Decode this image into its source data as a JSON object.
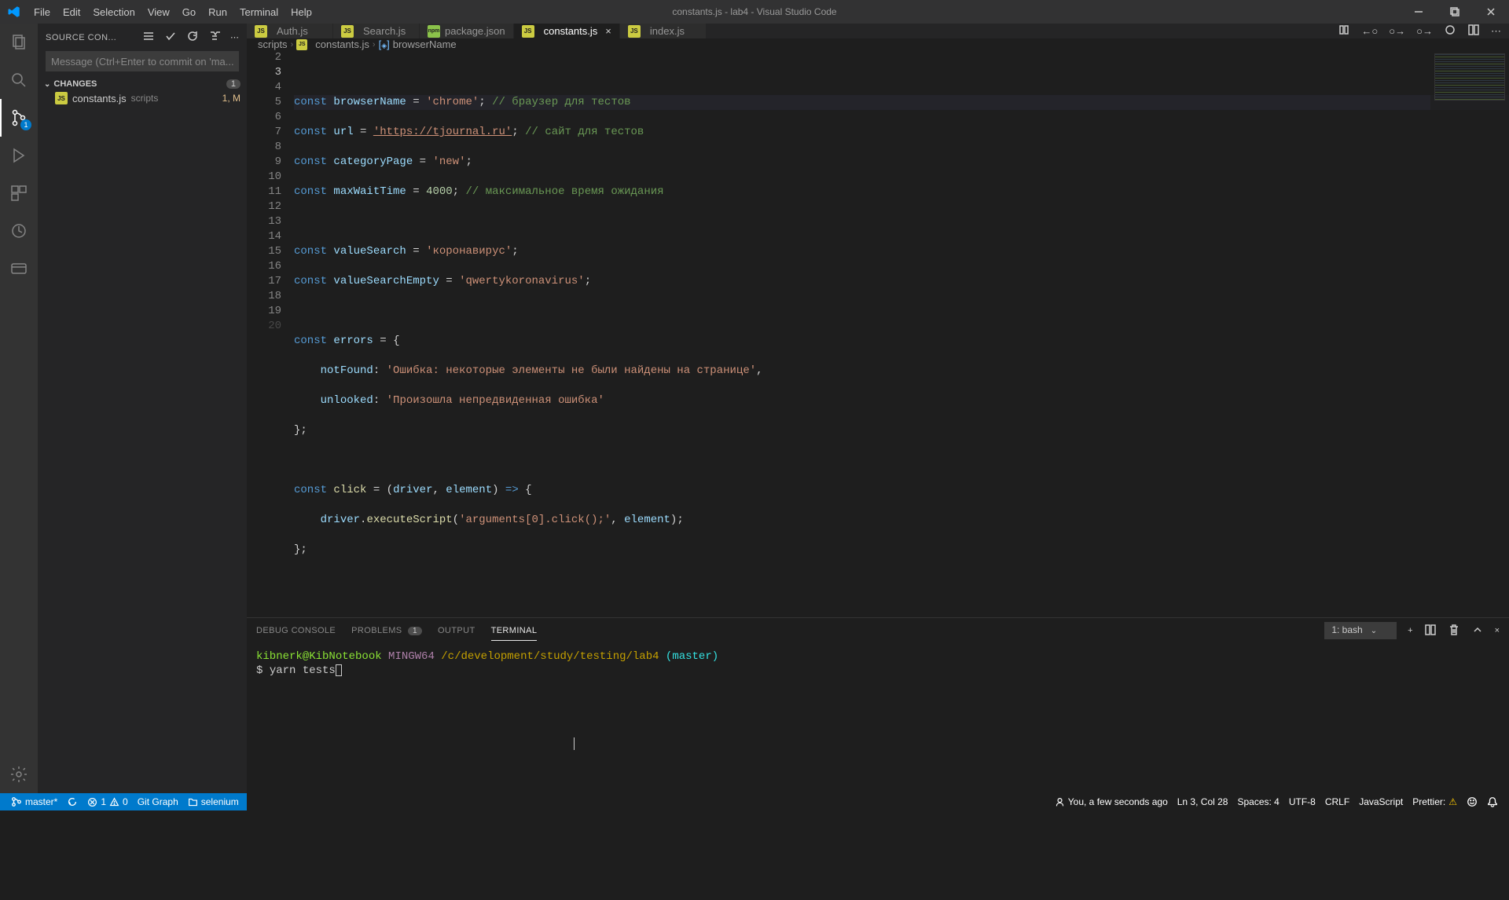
{
  "window": {
    "title": "constants.js - lab4 - Visual Studio Code"
  },
  "menubar": [
    "File",
    "Edit",
    "Selection",
    "View",
    "Go",
    "Run",
    "Terminal",
    "Help"
  ],
  "activity": {
    "scm_badge": "1"
  },
  "sidebar": {
    "title": "SOURCE CON...",
    "commit_placeholder": "Message (Ctrl+Enter to commit on 'ma...",
    "changes_label": "CHANGES",
    "changes_count": "1",
    "file": {
      "name": "constants.js",
      "folder": "scripts",
      "status": "1, M"
    }
  },
  "tabs": [
    {
      "icon": "js",
      "label": "Auth.js",
      "active": false
    },
    {
      "icon": "js",
      "label": "Search.js",
      "active": false
    },
    {
      "icon": "npm",
      "label": "package.json",
      "active": false
    },
    {
      "icon": "js",
      "label": "constants.js",
      "active": true
    },
    {
      "icon": "js",
      "label": "index.js",
      "active": false
    }
  ],
  "breadcrumb": {
    "seg1": "scripts",
    "seg2": "constants.js",
    "seg3": "browserName"
  },
  "code": {
    "l3": {
      "kw": "const",
      "v": "browserName",
      "s": "'chrome'",
      "c": "// браузер для тестов"
    },
    "l4": {
      "kw": "const",
      "v": "url",
      "s": "'https://tjournal.ru'",
      "c": "// сайт для тестов"
    },
    "l5": {
      "kw": "const",
      "v": "categoryPage",
      "s": "'new'"
    },
    "l6": {
      "kw": "const",
      "v": "maxWaitTime",
      "n": "4000",
      "c": "// максимальное время ожидания"
    },
    "l8": {
      "kw": "const",
      "v": "valueSearch",
      "s": "'коронавирус'"
    },
    "l9": {
      "kw": "const",
      "v": "valueSearchEmpty",
      "s": "'qwertykoronavirus'"
    },
    "l11": {
      "kw": "const",
      "v": "errors"
    },
    "l12": {
      "k": "notFound",
      "s": "'Ошибка: некоторые элементы не были найдены на странице'"
    },
    "l13": {
      "k": "unlooked",
      "s": "'Произошла непредвиденная ошибка'"
    },
    "l16": {
      "kw": "const",
      "v": "click",
      "p": "driver",
      "p2": "element"
    },
    "l17": {
      "obj": "driver",
      "fn": "executeScript",
      "s": "'arguments[0].click();'",
      "p": "element"
    }
  },
  "line_numbers": [
    "2",
    "3",
    "4",
    "5",
    "6",
    "7",
    "8",
    "9",
    "10",
    "11",
    "12",
    "13",
    "14",
    "15",
    "16",
    "17",
    "18",
    "19",
    "20"
  ],
  "panel": {
    "tabs": {
      "debug": "DEBUG CONSOLE",
      "problems": "PROBLEMS",
      "problems_badge": "1",
      "output": "OUTPUT",
      "terminal": "TERMINAL"
    },
    "terminal_select": "1: bash"
  },
  "terminal": {
    "user_host": "kibnerk@KibNotebook",
    "sys": "MINGW64",
    "path": "/c/development/study/testing/lab4",
    "branch": "(master)",
    "prompt": "$",
    "cmd": "yarn tests"
  },
  "statusbar": {
    "branch": "master*",
    "errors": "1",
    "warnings": "0",
    "gitgraph": "Git Graph",
    "folder": "selenium",
    "blame": "You, a few seconds ago",
    "pos": "Ln 3, Col 28",
    "spaces": "Spaces: 4",
    "encoding": "UTF-8",
    "eol": "CRLF",
    "lang": "JavaScript",
    "prettier": "Prettier:"
  }
}
